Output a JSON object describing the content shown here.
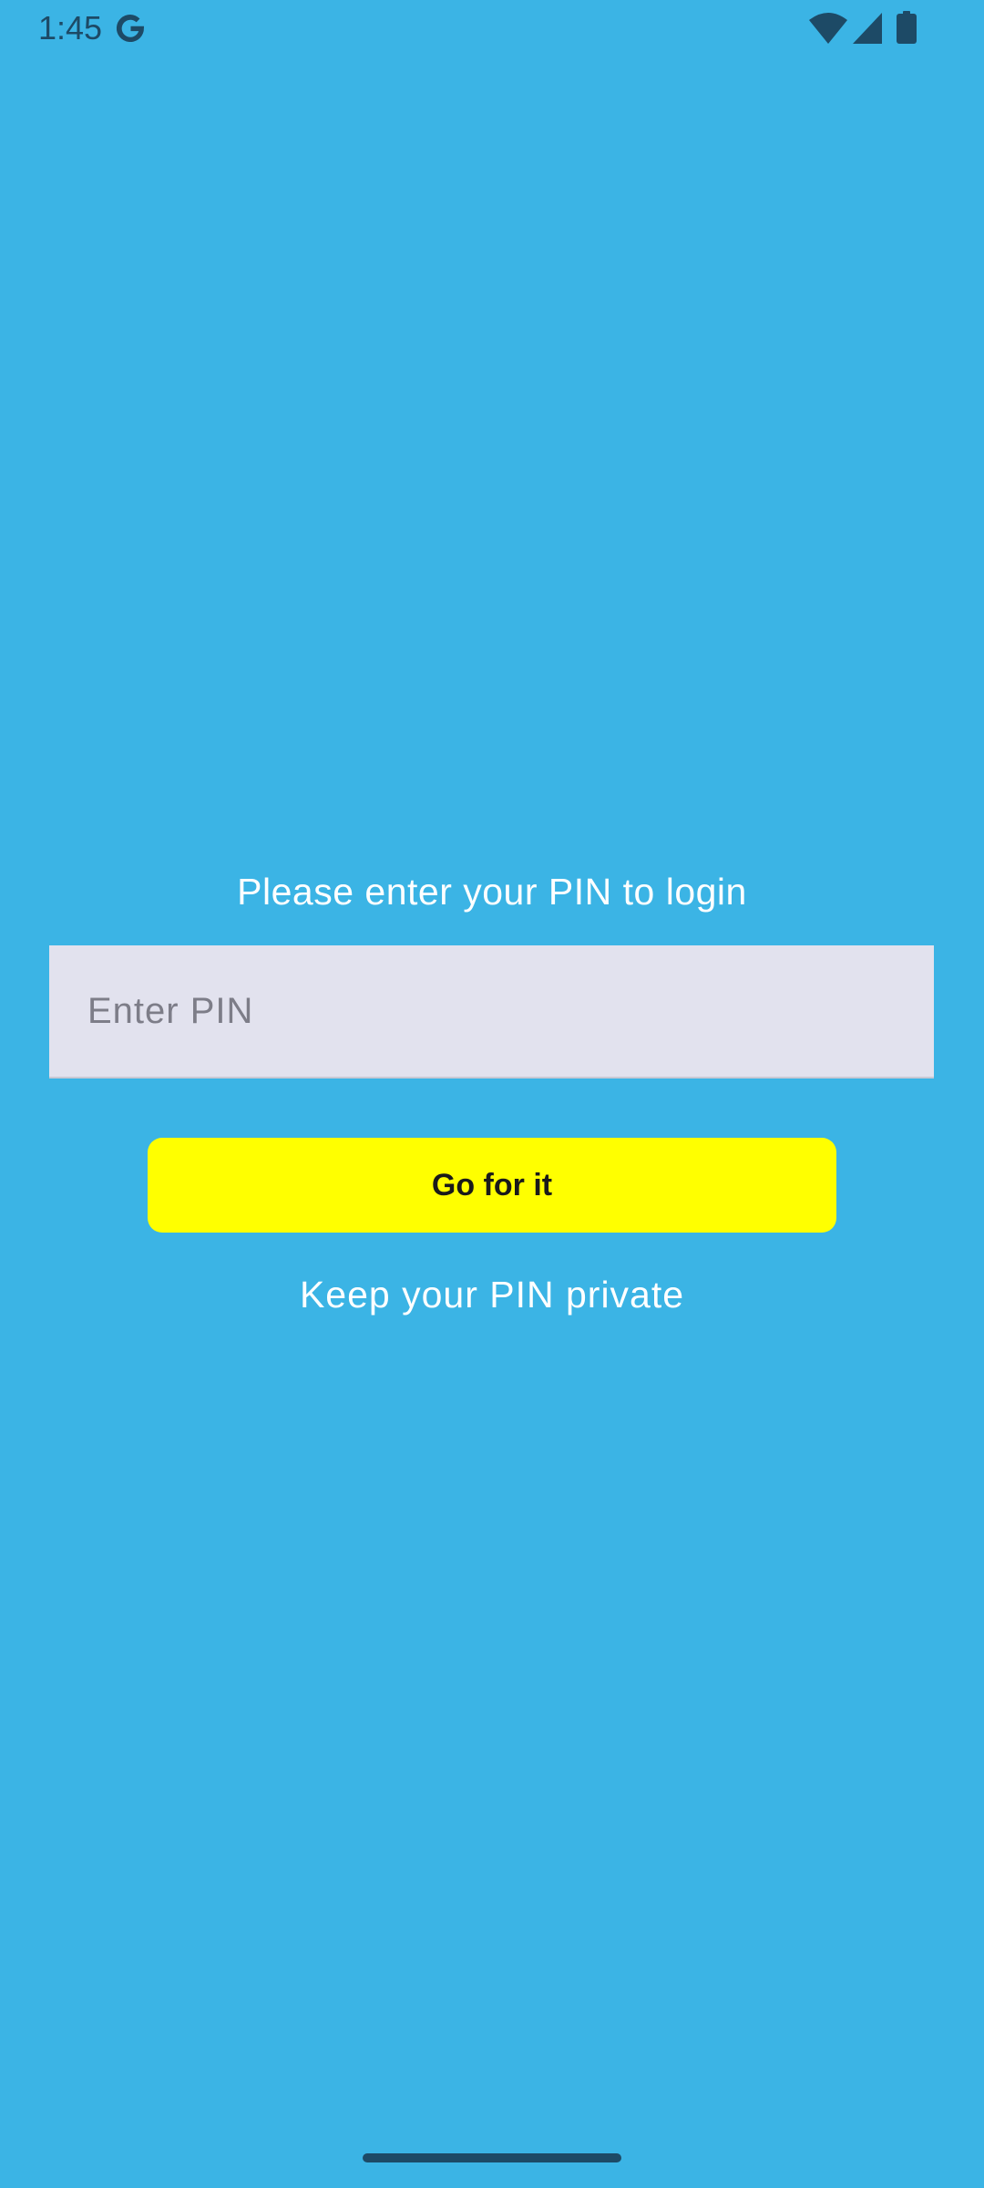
{
  "status_bar": {
    "time": "1:45",
    "icons": [
      "google-g-icon",
      "wifi-icon",
      "signal-icon",
      "battery-icon"
    ],
    "icon_color": "#1d4a66"
  },
  "login": {
    "prompt": "Please enter your PIN to login",
    "pin_placeholder": "Enter PIN",
    "pin_value": "",
    "submit_label": "Go for it",
    "hint": "Keep your PIN private"
  },
  "colors": {
    "background": "#3bb4e5",
    "field_background": "#e2e2ee",
    "button_background": "#ffff00",
    "text_light": "#ffffff"
  }
}
